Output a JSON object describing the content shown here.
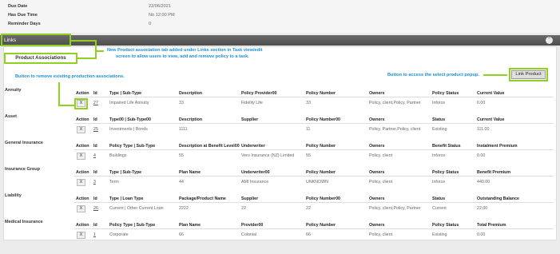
{
  "top_fields": [
    {
      "label": "Due Date",
      "value": "22/06/2021"
    },
    {
      "label": "Has Due Time",
      "value": "No 12:00 PM"
    },
    {
      "label": "Reminder Days",
      "value": "0"
    }
  ],
  "links": {
    "title": "Links",
    "collapse_icon": "⌃"
  },
  "tab": {
    "label": "Product Associations"
  },
  "callouts": {
    "tab_note_1": "New Product association tab added under Links section in Task view/edit",
    "tab_note_2": "screen to allow users to view, add and remove policy to a task.",
    "remove_note": "Button to remove existing production associations.",
    "link_note": "Button to access the select product popup."
  },
  "link_product_label": "Link Product",
  "remove_label": "X",
  "sections": [
    {
      "category": "Annuity",
      "headers": [
        "Action",
        "Id",
        "Type | Sub-Type",
        "Description",
        "Policy Provider00",
        "Policy Number",
        "Owners",
        "Policy Status",
        "Current Value"
      ],
      "row": [
        "27",
        "Impaired Life Annuity",
        "33",
        "Fidelity Life",
        "33",
        "Policy, client,Policy, Partner",
        "Inforce",
        "0.00"
      ]
    },
    {
      "category": "Asset",
      "headers": [
        "Action",
        "Id",
        "Type00 | Sub-Type00",
        "Description",
        "Supplier",
        "Policy Number00",
        "Owners",
        "Status",
        "Current Value"
      ],
      "row": [
        "25",
        "Investments | Bonds",
        "1111",
        "",
        "11",
        "Policy, Partner,Policy, client",
        "Existing",
        "111.00"
      ]
    },
    {
      "category": "General Insurance",
      "headers": [
        "Action",
        "Id",
        "Policy Type | Sub-Type",
        "Description at Benefit Level00",
        "Underwriter",
        "Policy Number",
        "Owners",
        "Benefit Status",
        "Instalment Premium"
      ],
      "row": [
        "4",
        "Buildings",
        "55",
        "Vero Insurance (NZ) Limited",
        "55",
        "Policy, client",
        "Inforce",
        "0.00"
      ]
    },
    {
      "category": "Insurance Group",
      "headers": [
        "Action",
        "Id",
        "Type | Sub-Type",
        "Plan Name",
        "Underwriter00",
        "Policy Number",
        "Owners",
        "Policy Status",
        "Benefit Premium"
      ],
      "row": [
        "3",
        "Term",
        "44",
        "AMI Insurance",
        "UNKNOWN",
        "Policy, client",
        "Inforce",
        "440.00"
      ]
    },
    {
      "category": "Liability",
      "headers": [
        "Action",
        "Id",
        "Type | Loan Type",
        "Package/Product Name",
        "Supplier",
        "Policy Number00",
        "Owners",
        "Status",
        "Outstanding Balance"
      ],
      "row": [
        "26",
        "Current | Other Current Loan",
        "2222",
        "22",
        "22",
        "Policy, client,Policy, Partner",
        "Current",
        "22.00"
      ]
    },
    {
      "category": "Medical Insurance",
      "headers": [
        "Action",
        "Id",
        "Policy Type | Sub-Type",
        "Plan Name",
        "Provider00",
        "Policy Number",
        "Owners",
        "Policy Status",
        "Total Premium"
      ],
      "row": [
        "1",
        "Corporate",
        "66",
        "Colonial",
        "66",
        "Policy, client",
        "Existing",
        "0.00"
      ]
    }
  ],
  "colors": {
    "annotation": "#8fd11e",
    "callout_text": "#1a8fd8",
    "bar": "#555555"
  }
}
